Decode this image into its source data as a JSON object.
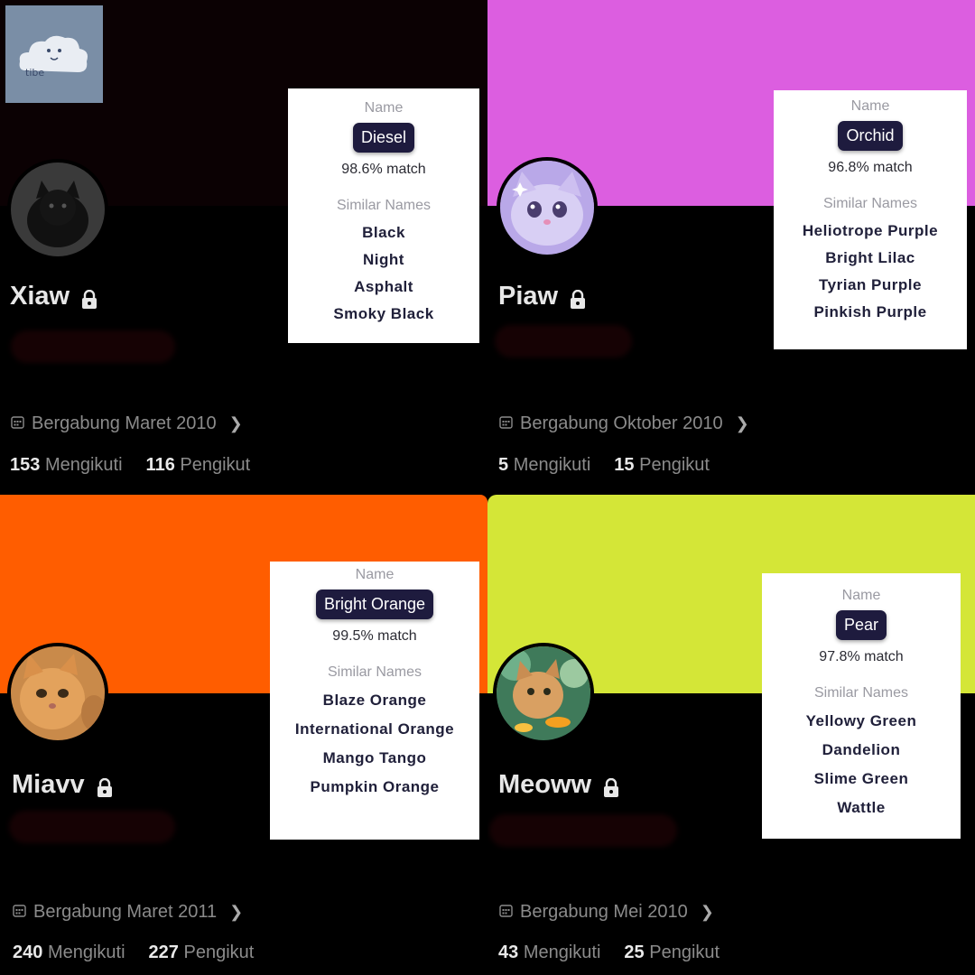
{
  "panels": [
    {
      "display_name": "Xiaw",
      "banner_color": "#0b0103",
      "joined": "Bergabung Maret 2010",
      "following_count": "153",
      "following_label": "Mengikuti",
      "followers_count": "116",
      "followers_label": "Pengikut",
      "color_card": {
        "name_label": "Name",
        "color_name": "Diesel",
        "match": "98.6% match",
        "similar_label": "Similar Names",
        "similar": [
          "Black",
          "Night",
          "Asphalt",
          "Smoky Black"
        ]
      }
    },
    {
      "display_name": "Piaw",
      "banner_color": "#dc5ee0",
      "joined": "Bergabung Oktober 2010",
      "following_count": "5",
      "following_label": "Mengikuti",
      "followers_count": "15",
      "followers_label": "Pengikut",
      "color_card": {
        "name_label": "Name",
        "color_name": "Orchid",
        "match": "96.8% match",
        "similar_label": "Similar Names",
        "similar": [
          "Heliotrope Purple",
          "Bright Lilac",
          "Tyrian Purple",
          "Pinkish Purple"
        ]
      }
    },
    {
      "display_name": "Miavv",
      "banner_color": "#ff5d00",
      "joined": "Bergabung Maret 2011",
      "following_count": "240",
      "following_label": "Mengikuti",
      "followers_count": "227",
      "followers_label": "Pengikut",
      "color_card": {
        "name_label": "Name",
        "color_name": "Bright Orange",
        "match": "99.5% match",
        "similar_label": "Similar Names",
        "similar": [
          "Blaze Orange",
          "International Orange",
          "Mango Tango",
          "Pumpkin Orange"
        ]
      }
    },
    {
      "display_name": "Meoww",
      "banner_color": "#d4e637",
      "joined": "Bergabung Mei 2010",
      "following_count": "43",
      "following_label": "Mengikuti",
      "followers_count": "25",
      "followers_label": "Pengikut",
      "color_card": {
        "name_label": "Name",
        "color_name": "Pear",
        "match": "97.8% match",
        "similar_label": "Similar Names",
        "similar": [
          "Yellowy Green",
          "Dandelion",
          "Slime Green",
          "Wattle"
        ]
      }
    }
  ],
  "logo_text": "tibe",
  "icons": {
    "lock": "lock-icon",
    "calendar": "calendar-icon",
    "chevron": "chevron-right-icon"
  }
}
